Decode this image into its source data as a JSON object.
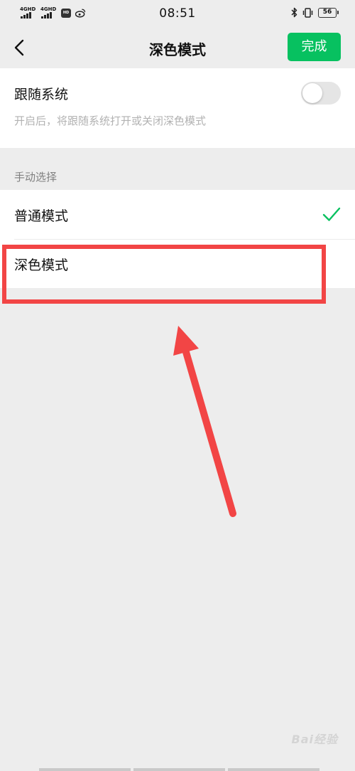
{
  "status_bar": {
    "time": "08:51",
    "network_1": "4GHD",
    "network_2": "4GHD",
    "battery": "56"
  },
  "nav": {
    "title": "深色模式",
    "done_label": "完成"
  },
  "follow_system": {
    "title": "跟随系统",
    "description": "开启后，将跟随系统打开或关闭深色模式",
    "enabled": false
  },
  "manual": {
    "section_label": "手动选择",
    "options": [
      {
        "label": "普通模式",
        "selected": true
      },
      {
        "label": "深色模式",
        "selected": false
      }
    ]
  },
  "watermark": "Bai经验",
  "colors": {
    "accent": "#07c160",
    "annotation": "#f24545",
    "background": "#ededed"
  }
}
